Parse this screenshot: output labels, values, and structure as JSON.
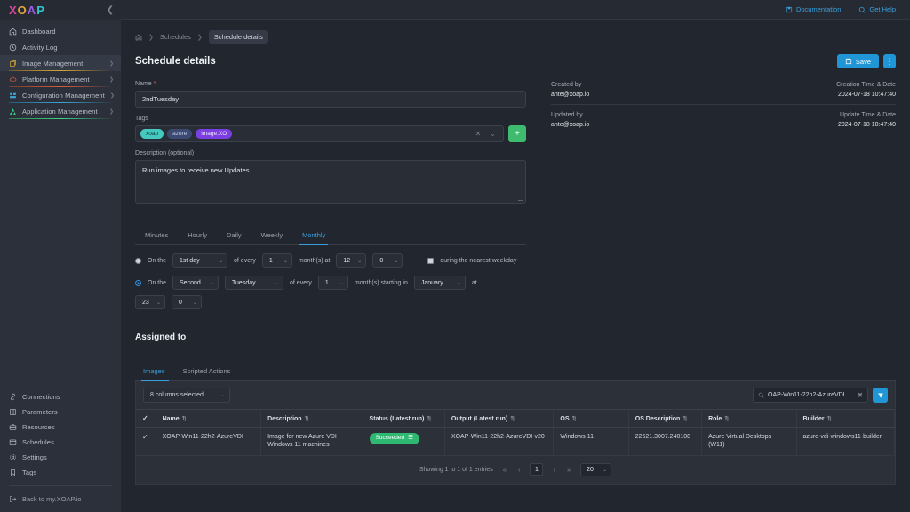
{
  "brand": {
    "name": "XOAP",
    "accent_blue": "#2196d6",
    "accent_green": "#3ebb6e"
  },
  "sidebar": {
    "collapse_icon": "chevron-left-icon",
    "nav": [
      {
        "label": "Dashboard",
        "icon": "home-icon",
        "group": false
      },
      {
        "label": "Activity Log",
        "icon": "clock-icon",
        "group": false
      },
      {
        "label": "Image Management",
        "icon": "image-icon",
        "group": true,
        "active": true
      },
      {
        "label": "Platform Management",
        "icon": "cloud-icon",
        "group": true,
        "active": false
      },
      {
        "label": "Configuration Management",
        "icon": "layers-icon",
        "group": true,
        "active": false
      },
      {
        "label": "Application Management",
        "icon": "apps-icon",
        "group": true,
        "active": false
      }
    ],
    "bottom": [
      {
        "label": "Connections",
        "icon": "link-icon"
      },
      {
        "label": "Parameters",
        "icon": "list-icon"
      },
      {
        "label": "Resources",
        "icon": "box-icon"
      },
      {
        "label": "Schedules",
        "icon": "calendar-icon"
      },
      {
        "label": "Settings",
        "icon": "gear-icon"
      },
      {
        "label": "Tags",
        "icon": "tag-icon"
      }
    ],
    "back_label": "Back to my.XOAP.io",
    "back_icon": "logout-icon"
  },
  "topbar": {
    "documentation": "Documentation",
    "documentation_icon": "book-icon",
    "get_help": "Get Help",
    "get_help_icon": "help-icon"
  },
  "breadcrumb": {
    "home_icon": "home-icon",
    "schedules": "Schedules",
    "current": "Schedule details"
  },
  "header": {
    "title": "Schedule details",
    "save_label": "Save",
    "save_icon": "save-icon",
    "kebab_icon": "more-vertical-icon"
  },
  "form": {
    "name_label": "Name",
    "name_value": "2ndTuesday",
    "tags_label": "Tags",
    "tags": [
      "xoap",
      "azure",
      "image.XO"
    ],
    "tag_clear_icon": "close-icon",
    "tag_chevron_icon": "chevron-down-icon",
    "tag_add_label": "+",
    "description_label": "Description (optional)",
    "description_value": "Run images to receive new Updates"
  },
  "meta": {
    "created_by_label": "Created by",
    "created_by_value": "ante@xoap.io",
    "creation_time_label": "Creation Time & Date",
    "creation_time_value": "2024-07-18 10:47:40",
    "updated_by_label": "Updated by",
    "updated_by_value": "ante@xoap.io",
    "update_time_label": "Update Time & Date",
    "update_time_value": "2024-07-18 10:47:40"
  },
  "schedule": {
    "tabs": [
      {
        "label": "Minutes",
        "active": false
      },
      {
        "label": "Hourly",
        "active": false
      },
      {
        "label": "Daily",
        "active": false
      },
      {
        "label": "Weekly",
        "active": false
      },
      {
        "label": "Monthly",
        "active": true
      }
    ],
    "row1": {
      "selected": false,
      "on_the": "On the",
      "day": "1st day",
      "of_every": "of every",
      "count": "1",
      "months_at": "month(s) at",
      "hour": "12",
      "minute": "0",
      "weekday_checkbox_label": "during the nearest weekday",
      "weekday_checked": true
    },
    "row2": {
      "selected": true,
      "on_the": "On the",
      "ordinal": "Second",
      "weekday": "Tuesday",
      "of_every": "of every",
      "count": "1",
      "months_starting_in": "month(s) starting in",
      "month": "January",
      "at": "at",
      "hour": "23",
      "minute": "0"
    }
  },
  "assigned": {
    "title": "Assigned to",
    "tabs": [
      {
        "label": "Images",
        "active": true
      },
      {
        "label": "Scripted Actions",
        "active": false
      }
    ],
    "columns_selector": "8 columns selected",
    "columns_chevron_icon": "chevron-down-icon",
    "search_icon": "search-icon",
    "search_value": "OAP-Win11-22h2-AzureVDI",
    "search_clear_icon": "clear-icon",
    "filter_icon": "funnel-icon",
    "table": {
      "header_check_icon": "check-icon",
      "sort_icon": "sort-icon",
      "columns": [
        "Name",
        "Description",
        "Status (Latest run)",
        "Output (Latest run)",
        "OS",
        "OS Description",
        "Role",
        "Builder"
      ],
      "rows": [
        {
          "checked": true,
          "name": "XOAP-Win11-22h2-AzureVDI",
          "description": "Image for new Azure VDI Windows 11 machines",
          "status": "Succeeded",
          "status_icon": "log-icon",
          "output": "XOAP-Win11-22h2-AzureVDI-v20",
          "os": "Windows 11",
          "os_description": "22621.3007.240108",
          "role": "Azure Virtual Desktops (W11)",
          "builder": "azure-vdi-windows11-builder"
        }
      ]
    },
    "pagination": {
      "info": "Showing 1 to 1 of 1 entries",
      "first_icon": "«",
      "prev_icon": "‹",
      "current_page": "1",
      "next_icon": "›",
      "last_icon": "»",
      "page_size": "20",
      "page_size_chevron_icon": "chevron-down-icon"
    }
  }
}
